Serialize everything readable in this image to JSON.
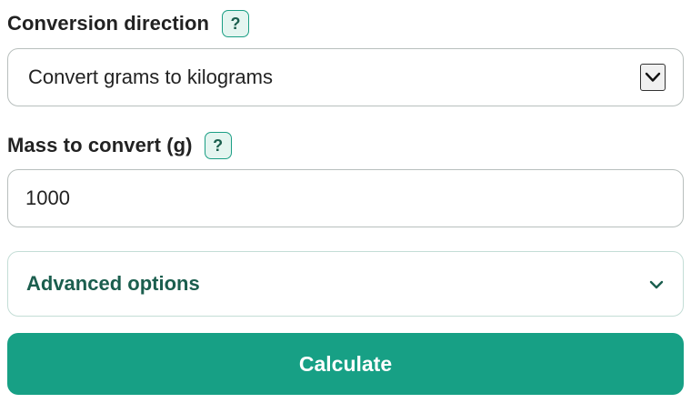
{
  "direction": {
    "label": "Conversion direction",
    "help": "?",
    "selected": "Convert grams to kilograms"
  },
  "mass": {
    "label": "Mass to convert (g)",
    "help": "?",
    "value": "1000"
  },
  "advanced": {
    "label": "Advanced options",
    "icon": "chevron-down-icon"
  },
  "calculate": {
    "label": "Calculate"
  },
  "colors": {
    "accent": "#17a085",
    "accent_dark": "#1b5e4e",
    "help_bg": "#e4f5f0",
    "border": "#b8bfbd"
  }
}
